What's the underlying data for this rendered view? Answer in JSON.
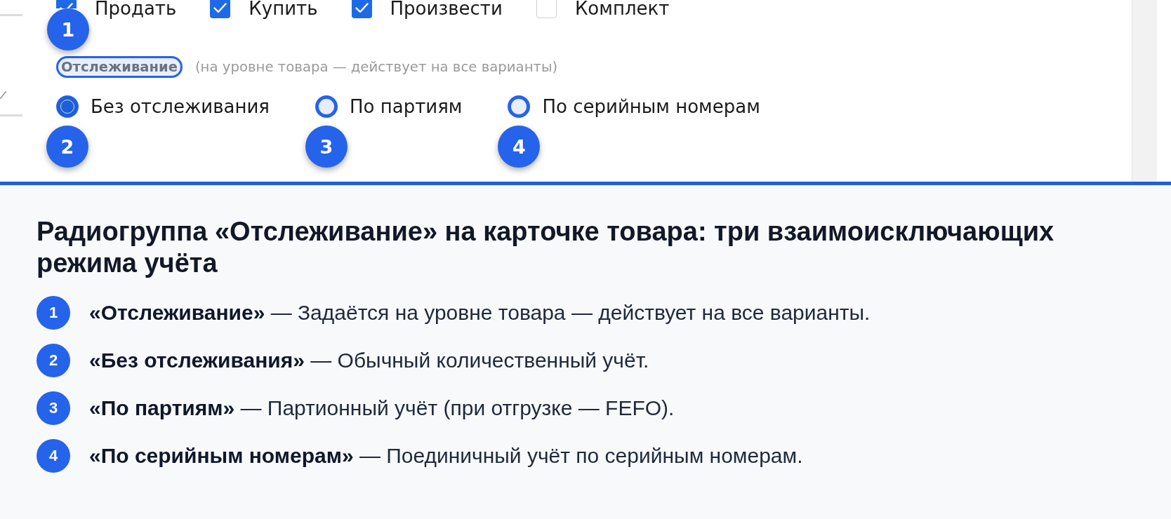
{
  "product_form": {
    "checkboxes": [
      {
        "label": "Продать",
        "checked": true
      },
      {
        "label": "Купить",
        "checked": true
      },
      {
        "label": "Произвести",
        "checked": true
      },
      {
        "label": "Комплект",
        "checked": false
      }
    ],
    "tracking": {
      "label": "Отслеживание",
      "highlighted": true,
      "marker": "1",
      "hint": "(на уровне товара — действует на все варианты)",
      "options": [
        {
          "label": "Без отслеживания",
          "selected": true,
          "marker": "2"
        },
        {
          "label": "По партиям",
          "selected": false,
          "marker": "3"
        },
        {
          "label": "По серийным номерам",
          "selected": false,
          "marker": "4"
        }
      ]
    }
  },
  "legend": {
    "title": "Радиогруппа «Отслеживание» на карточке товара: три взаимоисключающих режима учёта",
    "items": [
      {
        "number": "1",
        "text": "**«Отслеживание»** — Задаётся на уровне товара — действует на все варианты."
      },
      {
        "number": "2",
        "text": "**«Без отслеживания»** — Обычный количественный учёт."
      },
      {
        "number": "3",
        "text": "**«По партиям»** — Партионный учёт (при отгрузке — FEFO)."
      },
      {
        "number": "4",
        "text": "**«По серийным номерам»** — Поединичный учёт по серийным номерам."
      }
    ]
  }
}
